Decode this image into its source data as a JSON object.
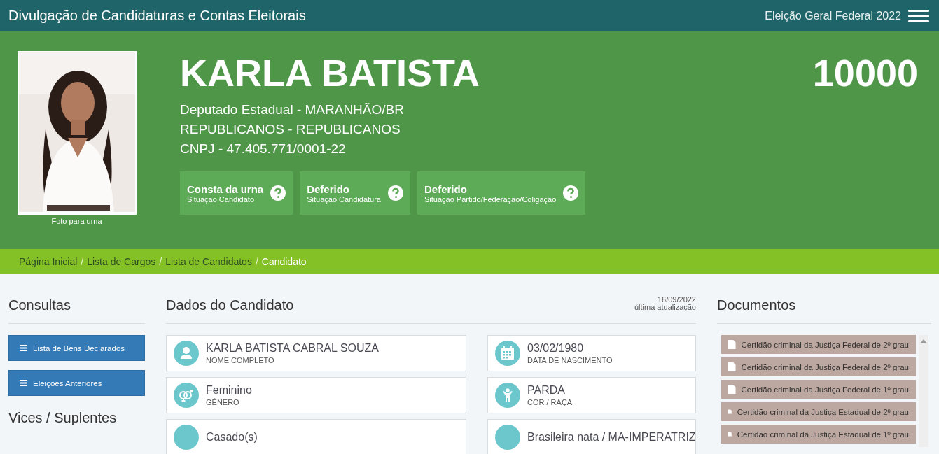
{
  "topbar": {
    "title": "Divulgação de Candidaturas e Contas Eleitorais",
    "election": "Eleição Geral Federal 2022"
  },
  "candidate": {
    "photo": {
      "kind": "picture"
    },
    "photo_caption": "Foto para urna",
    "name": "KARLA BATISTA",
    "number": "10000",
    "details": [
      "Deputado Estadual - MARANHÃO/BR",
      "REPUBLICANOS - REPUBLICANOS",
      "CNPJ - 47.405.771/0001-22"
    ],
    "statuses": [
      {
        "value": "Consta da urna",
        "label": "Situação Candidato"
      },
      {
        "value": "Deferido",
        "label": "Situação Candidatura"
      },
      {
        "value": "Deferido",
        "label": "Situação Partido/Federação/Coligação"
      }
    ]
  },
  "breadcrumb": [
    {
      "label": "Página Inicial",
      "current": false
    },
    {
      "separator": "/",
      "label": "Lista de Cargos",
      "current": false
    },
    {
      "separator": "/",
      "label": "Lista de Candidatos",
      "current": false
    },
    {
      "separator": "/",
      "label": "Candidato",
      "current": true
    }
  ],
  "consultas": {
    "title": "Consultas",
    "buttons": [
      "Lista de Bens Declarados",
      "Eleições Anteriores"
    ]
  },
  "vices": {
    "title": "Vices / Suplentes"
  },
  "dados": {
    "title": "Dados do Candidato",
    "updated_date": "16/09/2022",
    "updated_label": "última atualização",
    "fields": [
      {
        "kind": "person",
        "value": "KARLA BATISTA CABRAL SOUZA",
        "label": "NOME COMPLETO"
      },
      {
        "kind": "calendar",
        "value": "03/02/1980",
        "label": "DATA DE NASCIMENTO"
      },
      {
        "kind": "gender",
        "value": "Feminino",
        "label": "GÊNERO"
      },
      {
        "kind": "figure",
        "value": "PARDA",
        "label": "COR / RAÇA"
      },
      {
        "kind": "plain",
        "value": "Casado(s)"
      },
      {
        "kind": "plain",
        "value": "Brasileira nata / MA-IMPERATRIZ"
      }
    ]
  },
  "documentos": {
    "title": "Documentos",
    "items": [
      "Certidão criminal da Justiça Federal de 2º grau",
      "Certidão criminal da Justiça Federal de 2º grau",
      "Certidão criminal da Justiça Federal de 1º grau",
      "Certidão criminal da Justiça Estadual de 2º grau",
      "Certidão criminal da Justiça Estadual de 1º grau"
    ]
  }
}
